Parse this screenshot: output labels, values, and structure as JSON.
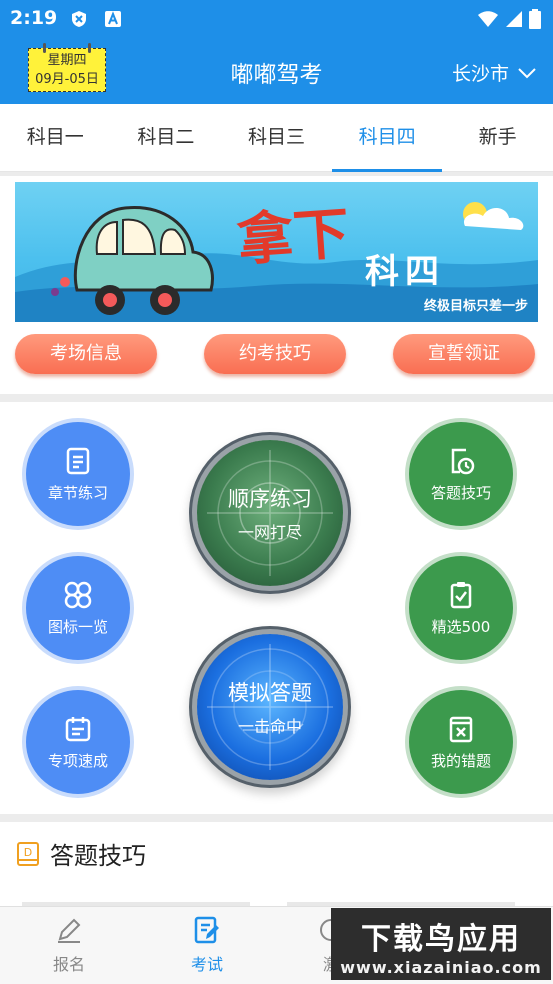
{
  "status_bar": {
    "time": "2:19"
  },
  "header": {
    "date_weekday": "星期四",
    "date_day": "09月-05日",
    "title": "嘟嘟驾考",
    "city": "长沙市"
  },
  "tabs": [
    {
      "label": "科目一",
      "active": false
    },
    {
      "label": "科目二",
      "active": false
    },
    {
      "label": "科目三",
      "active": false
    },
    {
      "label": "科目四",
      "active": true
    },
    {
      "label": "新手",
      "active": false
    }
  ],
  "banner": {
    "headline": "拿下",
    "subject": "科四",
    "slogan": "终极目标只差一步"
  },
  "pills": [
    "考场信息",
    "约考技巧",
    "宣誓领证"
  ],
  "practice": {
    "chapter": {
      "label": "章节练习",
      "icon": "document-icon"
    },
    "icons_overview": {
      "label": "图标一览",
      "icon": "clover-icon"
    },
    "special": {
      "label": "专项速成",
      "icon": "calendar-icon"
    },
    "tips": {
      "label": "答题技巧",
      "icon": "clock-document-icon"
    },
    "selected": {
      "label": "精选500",
      "icon": "clipboard-icon"
    },
    "mistakes": {
      "label": "我的错题",
      "icon": "error-book-icon"
    },
    "sequential": {
      "title": "顺序练习",
      "subtitle": "一网打尽"
    },
    "mock": {
      "title": "模拟答题",
      "subtitle": "一击命中"
    }
  },
  "tips_section": {
    "title": "答题技巧"
  },
  "bottom_nav": [
    {
      "label": "报名",
      "active": false
    },
    {
      "label": "考试",
      "active": true
    },
    {
      "label": "激",
      "active": false
    }
  ],
  "watermark": {
    "title": "下载鸟应用",
    "url": "www.xiazainiao.com"
  },
  "colors": {
    "primary": "#1e8fe8",
    "accent_green": "#3c9a4d",
    "accent_blue": "#4e8df5",
    "pill": "#f96e52"
  }
}
